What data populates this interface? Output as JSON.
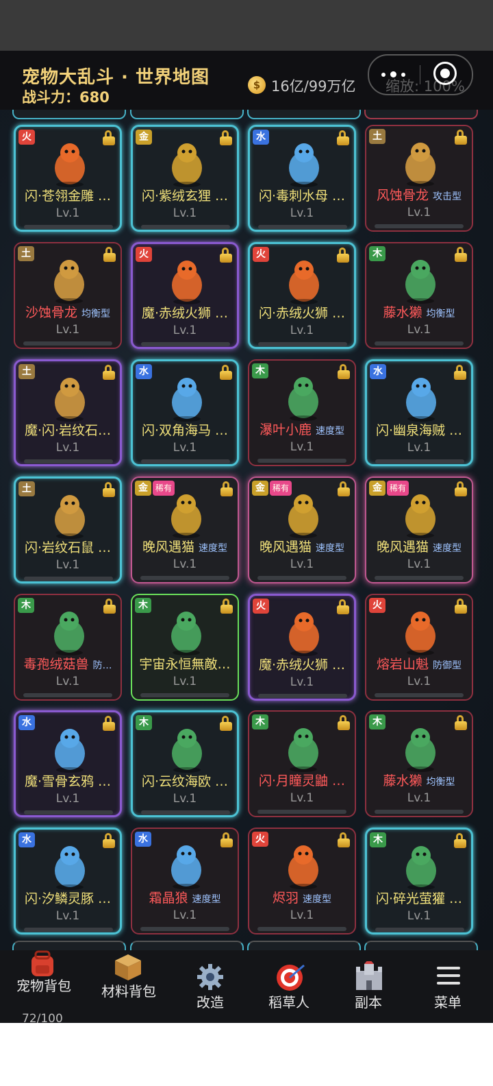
{
  "header": {
    "title": "宠物大乱斗 · 世界地图",
    "power": "战斗力：680",
    "currency": "16亿/99万亿",
    "zoom": "缩放: 100%"
  },
  "pets": [
    {
      "element": "火",
      "name": "闪·苍翎金雕 …",
      "role": "",
      "level": "Lv.1",
      "style": "flash",
      "rare": ""
    },
    {
      "element": "金",
      "name": "闪·紫绒玄狸 …",
      "role": "",
      "level": "Lv.1",
      "style": "flash",
      "rare": ""
    },
    {
      "element": "水",
      "name": "闪·毒刺水母 …",
      "role": "",
      "level": "Lv.1",
      "style": "flash",
      "rare": ""
    },
    {
      "element": "土",
      "name": "风蚀骨龙",
      "role": "攻击型",
      "level": "Lv.1",
      "style": "red",
      "rare": ""
    },
    {
      "element": "土",
      "name": "沙蚀骨龙",
      "role": "均衡型",
      "level": "Lv.1",
      "style": "red",
      "rare": ""
    },
    {
      "element": "火",
      "name": "魔·赤绒火狮 …",
      "role": "",
      "level": "Lv.1",
      "style": "magic",
      "rare": ""
    },
    {
      "element": "火",
      "name": "闪·赤绒火狮 …",
      "role": "",
      "level": "Lv.1",
      "style": "flash",
      "rare": ""
    },
    {
      "element": "木",
      "name": "藤水獭",
      "role": "均衡型",
      "level": "Lv.1",
      "style": "red",
      "rare": ""
    },
    {
      "element": "土",
      "name": "魔·闪·岩纹石…",
      "role": "",
      "level": "Lv.1",
      "style": "magic",
      "rare": ""
    },
    {
      "element": "水",
      "name": "闪·双角海马 …",
      "role": "",
      "level": "Lv.1",
      "style": "flash",
      "rare": ""
    },
    {
      "element": "木",
      "name": "瀑叶小鹿",
      "role": "速度型",
      "level": "Lv.1",
      "style": "red",
      "rare": ""
    },
    {
      "element": "水",
      "name": "闪·幽泉海贼 …",
      "role": "",
      "level": "Lv.1",
      "style": "flash",
      "rare": ""
    },
    {
      "element": "土",
      "name": "闪·岩纹石鼠 …",
      "role": "",
      "level": "Lv.1",
      "style": "flash",
      "rare": ""
    },
    {
      "element": "金",
      "name": "晚风遇猫",
      "role": "速度型",
      "level": "Lv.1",
      "style": "pink",
      "rare": "稀有"
    },
    {
      "element": "金",
      "name": "晚风遇猫",
      "role": "速度型",
      "level": "Lv.1",
      "style": "pink",
      "rare": "稀有"
    },
    {
      "element": "金",
      "name": "晚风遇猫",
      "role": "速度型",
      "level": "Lv.1",
      "style": "pink",
      "rare": "稀有"
    },
    {
      "element": "木",
      "name": "毒孢绒菇兽",
      "role": "防…",
      "level": "Lv.1",
      "style": "red",
      "rare": ""
    },
    {
      "element": "木",
      "name": "宇宙永恒無敵…",
      "role": "",
      "level": "Lv.1",
      "style": "green",
      "rare": ""
    },
    {
      "element": "火",
      "name": "魔·赤绒火狮 …",
      "role": "",
      "level": "Lv.1",
      "style": "magic",
      "rare": ""
    },
    {
      "element": "火",
      "name": "熔岩山魁",
      "role": "防御型",
      "level": "Lv.1",
      "style": "red",
      "rare": ""
    },
    {
      "element": "水",
      "name": "魔·雪骨玄鸦 …",
      "role": "",
      "level": "Lv.1",
      "style": "magic",
      "rare": ""
    },
    {
      "element": "木",
      "name": "闪·云纹海欧 …",
      "role": "",
      "level": "Lv.1",
      "style": "flash",
      "rare": ""
    },
    {
      "element": "木",
      "name": "闪·月瞳灵鼬 …",
      "role": "",
      "level": "Lv.1",
      "style": "red",
      "rare": ""
    },
    {
      "element": "木",
      "name": "藤水獭",
      "role": "均衡型",
      "level": "Lv.1",
      "style": "red",
      "rare": ""
    },
    {
      "element": "水",
      "name": "闪·汐鳞灵豚 …",
      "role": "",
      "level": "Lv.1",
      "style": "flash",
      "rare": ""
    },
    {
      "element": "水",
      "name": "霜晶狼",
      "role": "速度型",
      "level": "Lv.1",
      "style": "red",
      "rare": ""
    },
    {
      "element": "火",
      "name": "烬羽",
      "role": "速度型",
      "level": "Lv.1",
      "style": "red",
      "rare": ""
    },
    {
      "element": "木",
      "name": "闪·碎光萤獾 …",
      "role": "",
      "level": "Lv.1",
      "style": "flash",
      "rare": ""
    }
  ],
  "bottom_nav": {
    "pet_bag": "宠物背包",
    "pet_bag_count": "72/100",
    "material_bag": "材料背包",
    "modify": "改造",
    "scarecrow": "稻草人",
    "dungeon": "副本",
    "menu": "菜单"
  },
  "colors": {
    "title_gold": "#f3d27a",
    "flash_border": "#4cc2d4",
    "magic_border": "#8a5ad0",
    "rare_border": "#8e3040",
    "pink_border": "#c05890"
  }
}
